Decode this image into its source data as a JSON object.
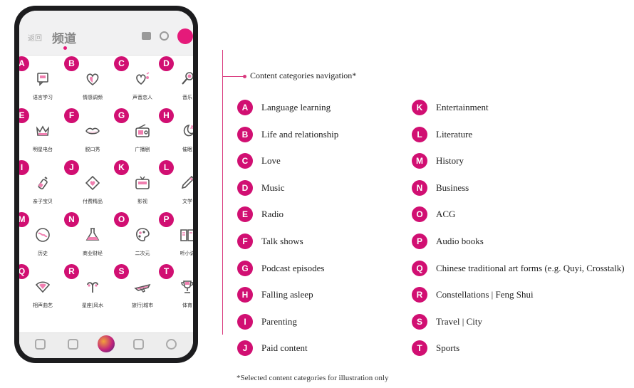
{
  "phone": {
    "back_label": "返回",
    "title": "频道",
    "categories": [
      {
        "letter": "A",
        "label": "语言学习",
        "icon": "speech-bubble-icon"
      },
      {
        "letter": "B",
        "label": "情感调频",
        "icon": "heart-icon"
      },
      {
        "letter": "C",
        "label": "声音恋人",
        "icon": "heart-sound-icon"
      },
      {
        "letter": "D",
        "label": "音乐",
        "icon": "microphone-icon"
      },
      {
        "letter": "E",
        "label": "明星电台",
        "icon": "crown-icon"
      },
      {
        "letter": "F",
        "label": "脱口秀",
        "icon": "lips-icon"
      },
      {
        "letter": "G",
        "label": "广播剧",
        "icon": "radio-icon"
      },
      {
        "letter": "H",
        "label": "催眠",
        "icon": "moon-icon"
      },
      {
        "letter": "I",
        "label": "亲子宝贝",
        "icon": "baby-bottle-icon"
      },
      {
        "letter": "J",
        "label": "付费精品",
        "icon": "diamond-heart-icon"
      },
      {
        "letter": "K",
        "label": "影视",
        "icon": "tv-icon"
      },
      {
        "letter": "L",
        "label": "文学",
        "icon": "pen-icon"
      },
      {
        "letter": "M",
        "label": "历史",
        "icon": "globe-icon"
      },
      {
        "letter": "N",
        "label": "商业财经",
        "icon": "flask-icon"
      },
      {
        "letter": "O",
        "label": "二次元",
        "icon": "palette-icon"
      },
      {
        "letter": "P",
        "label": "听小说",
        "icon": "book-icon"
      },
      {
        "letter": "Q",
        "label": "相声曲艺",
        "icon": "fan-icon"
      },
      {
        "letter": "R",
        "label": "星座|风水",
        "icon": "aries-icon"
      },
      {
        "letter": "S",
        "label": "旅行|城市",
        "icon": "airplane-icon"
      },
      {
        "letter": "T",
        "label": "体育",
        "icon": "trophy-icon"
      }
    ]
  },
  "annotation": "Content categories navigation*",
  "legend_left": [
    {
      "letter": "A",
      "label": "Language learning"
    },
    {
      "letter": "B",
      "label": "Life and relationship"
    },
    {
      "letter": "C",
      "label": "Love"
    },
    {
      "letter": "D",
      "label": "Music"
    },
    {
      "letter": "E",
      "label": "Radio"
    },
    {
      "letter": "F",
      "label": "Talk shows"
    },
    {
      "letter": "G",
      "label": "Podcast episodes"
    },
    {
      "letter": "H",
      "label": "Falling asleep"
    },
    {
      "letter": "I",
      "label": "Parenting"
    },
    {
      "letter": "J",
      "label": "Paid content"
    }
  ],
  "legend_right": [
    {
      "letter": "K",
      "label": "Entertainment"
    },
    {
      "letter": "L",
      "label": "Literature"
    },
    {
      "letter": "M",
      "label": "History"
    },
    {
      "letter": "N",
      "label": "Business"
    },
    {
      "letter": "O",
      "label": "ACG"
    },
    {
      "letter": "P",
      "label": "Audio books"
    },
    {
      "letter": "Q",
      "label": "Chinese traditional art forms (e.g. Quyi, Crosstalk)"
    },
    {
      "letter": "R",
      "label": "Constellations | Feng Shui"
    },
    {
      "letter": "S",
      "label": "Travel | City"
    },
    {
      "letter": "T",
      "label": "Sports"
    }
  ],
  "footnote": "*Selected content categories for illustration only",
  "colors": {
    "accent": "#d10f72",
    "icon_stroke": "#555555",
    "icon_accent": "#f07fb0"
  }
}
